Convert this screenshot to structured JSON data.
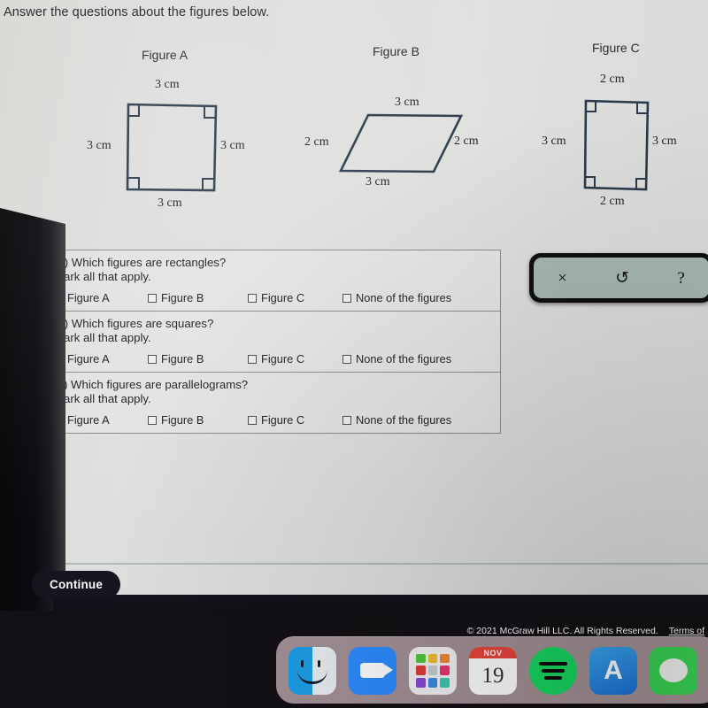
{
  "prompt": "Answer the questions about the figures below.",
  "figures": [
    {
      "title": "Figure A",
      "shape": "square",
      "labels": {
        "top": "3 cm",
        "left": "3 cm",
        "right": "3 cm",
        "bottom": "3 cm"
      },
      "right_angle_marks": 4
    },
    {
      "title": "Figure B",
      "shape": "parallelogram",
      "labels": {
        "top": "3 cm",
        "left": "2 cm",
        "right": "2 cm",
        "bottom": "3 cm"
      },
      "right_angle_marks": 0
    },
    {
      "title": "Figure C",
      "shape": "rectangle",
      "labels": {
        "top": "2 cm",
        "left": "3 cm",
        "right": "3 cm",
        "bottom": "2 cm"
      },
      "right_angle_marks": 4
    }
  ],
  "questions": [
    {
      "prompt_line1": "(a) Which figures are rectangles?",
      "prompt_line2": "Mark all that apply.",
      "options": [
        "Figure A",
        "Figure B",
        "Figure C",
        "None of the figures"
      ],
      "checked": [
        false,
        false,
        false,
        false
      ]
    },
    {
      "prompt_line1": "(b) Which figures are squares?",
      "prompt_line2": "Mark all that apply.",
      "options": [
        "Figure A",
        "Figure B",
        "Figure C",
        "None of the figures"
      ],
      "checked": [
        false,
        false,
        false,
        false
      ]
    },
    {
      "prompt_line1": "(c) Which figures are parallelograms?",
      "prompt_line2": "Mark all that apply.",
      "options": [
        "Figure A",
        "Figure B",
        "Figure C",
        "None of the figures"
      ],
      "checked": [
        false,
        false,
        false,
        false
      ]
    }
  ],
  "toolbar": {
    "close_glyph": "×",
    "undo_glyph": "↺",
    "help_glyph": "?",
    "background_color": "#a7b6b2"
  },
  "continue_button": "Continue",
  "footer": {
    "copyright": "© 2021 McGraw Hill LLC. All Rights Reserved.",
    "terms_link": "Terms of"
  },
  "dock": {
    "items": [
      {
        "name": "Finder"
      },
      {
        "name": "Zoom"
      },
      {
        "name": "Launchpad"
      },
      {
        "name": "Calendar",
        "month": "NOV",
        "day": "19"
      },
      {
        "name": "Spotify"
      },
      {
        "name": "App Store"
      },
      {
        "name": "Messages"
      }
    ]
  }
}
